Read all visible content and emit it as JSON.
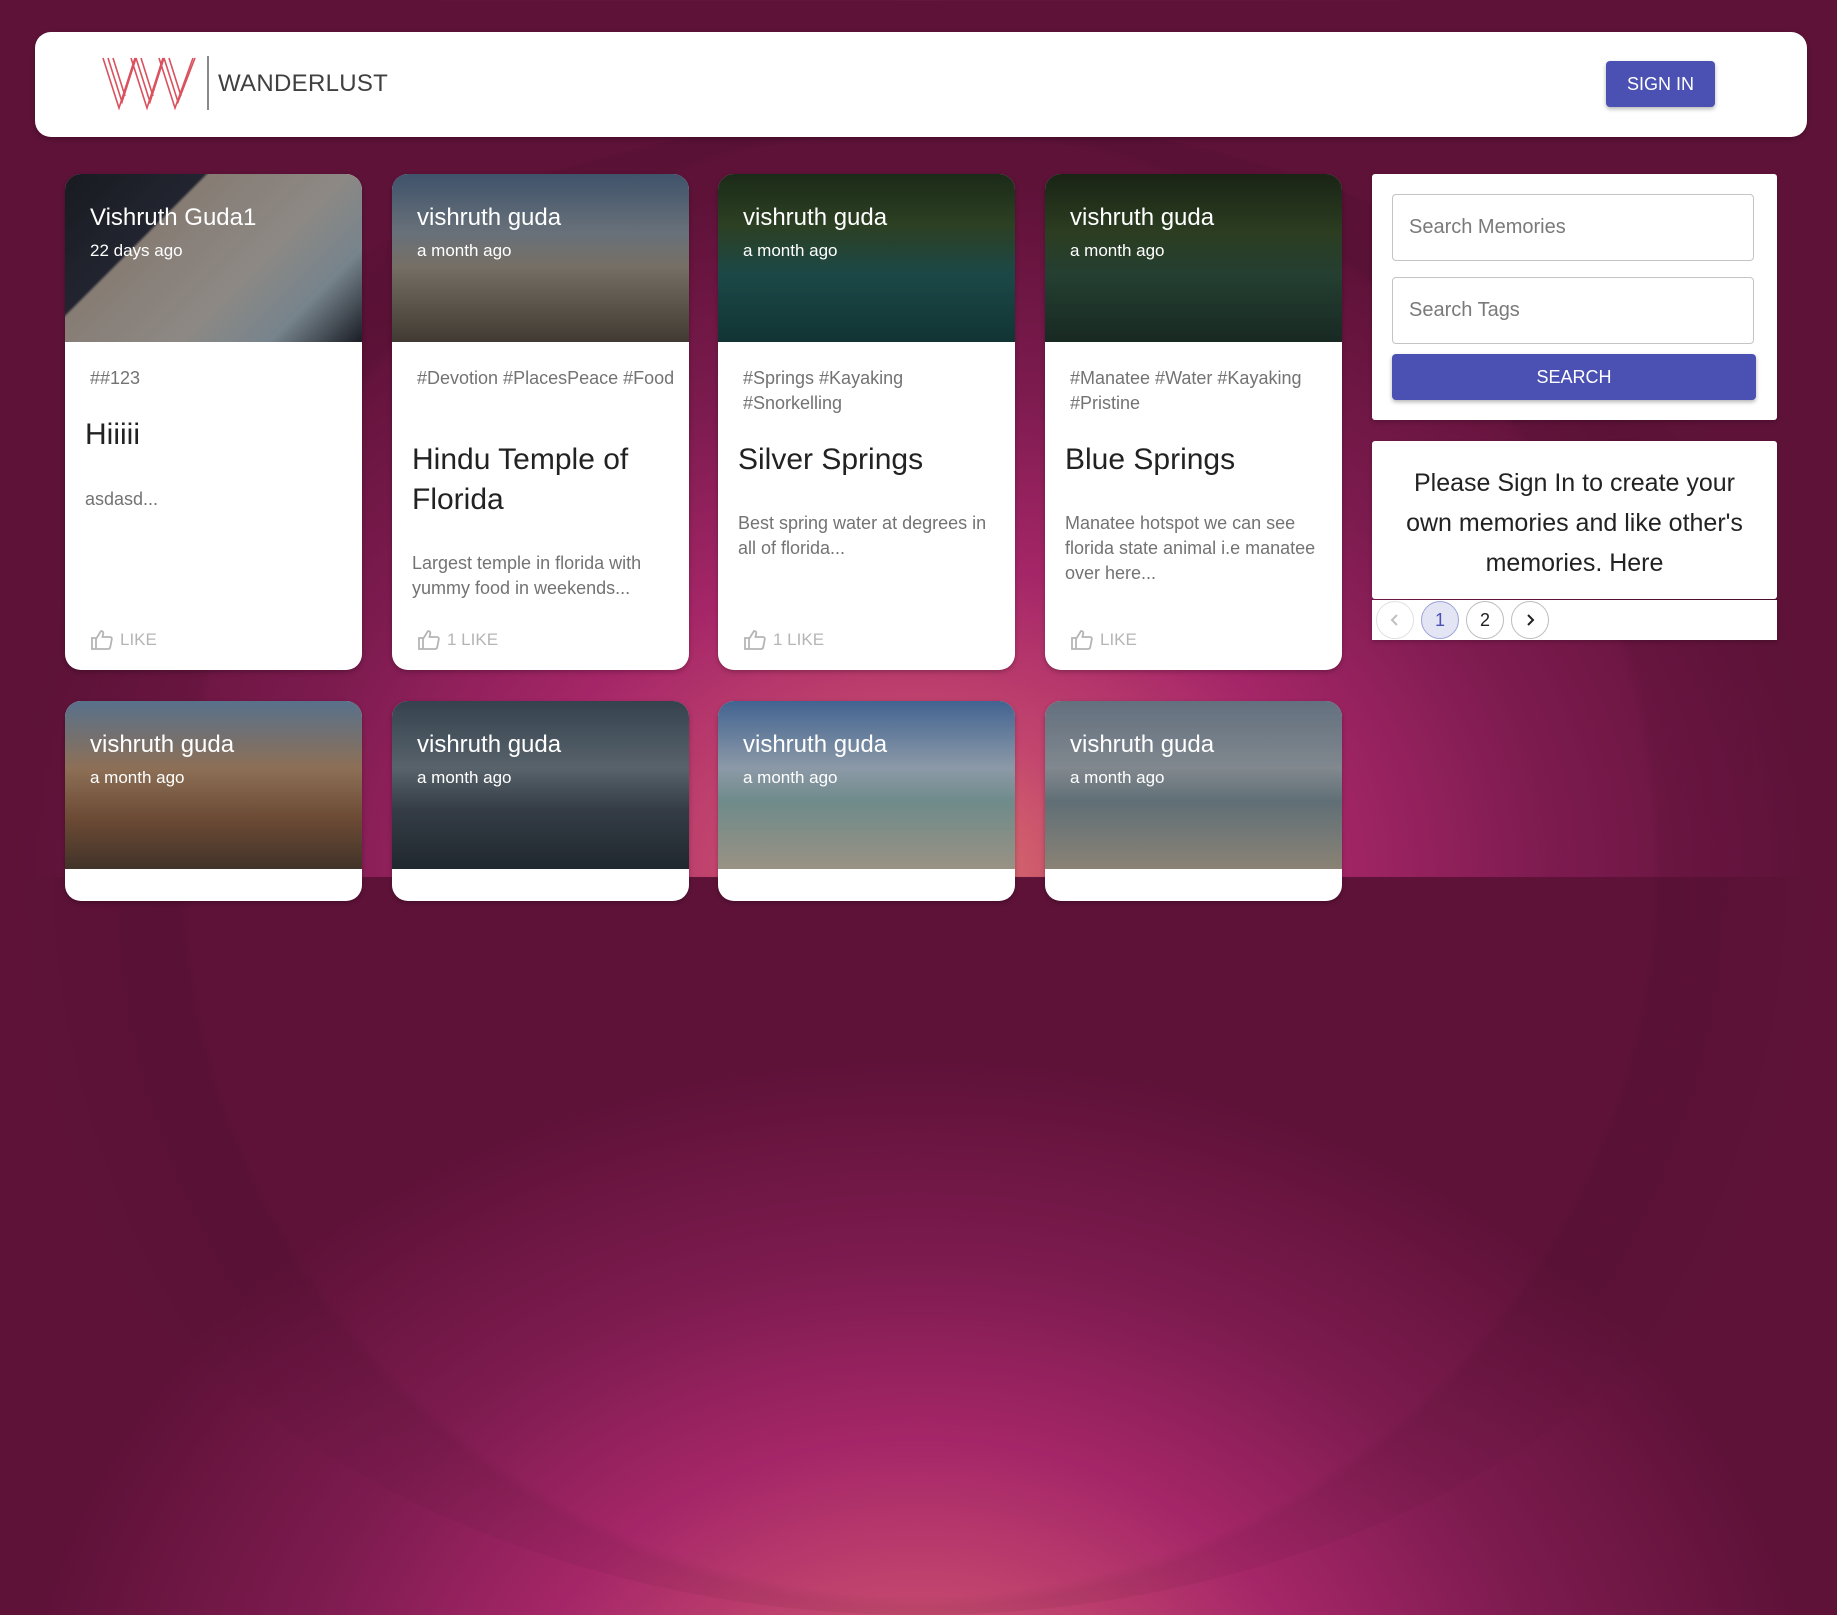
{
  "header": {
    "brand": "WANDERLUST",
    "sign_in_label": "SIGN IN",
    "logo_color": "#d9525e"
  },
  "posts": [
    {
      "author": "Vishruth Guda1",
      "time": "22 days ago",
      "tags": "##123",
      "title": "Hiiiii",
      "desc": "asdasd...",
      "like": "LIKE"
    },
    {
      "author": "vishruth guda",
      "time": "a month ago",
      "tags": "#Devotion #PlacesPeace #Food",
      "title": "Hindu Temple of Florida",
      "desc": "Largest temple in florida with yummy food in weekends...",
      "like": "1 LIKE"
    },
    {
      "author": "vishruth guda",
      "time": "a month ago",
      "tags": "#Springs #Kayaking #Snorkelling",
      "title": "Silver Springs",
      "desc": "Best spring water at degrees in all of florida...",
      "like": "1 LIKE"
    },
    {
      "author": "vishruth guda",
      "time": "a month ago",
      "tags": "#Manatee #Water #Kayaking #Pristine",
      "title": "Blue Springs",
      "desc": "Manatee hotspot we can see florida state animal i.e manatee over here...",
      "like": "LIKE"
    },
    {
      "author": "vishruth guda",
      "time": "a month ago"
    },
    {
      "author": "vishruth guda",
      "time": "a month ago"
    },
    {
      "author": "vishruth guda",
      "time": "a month ago"
    },
    {
      "author": "vishruth guda",
      "time": "a month ago"
    }
  ],
  "search": {
    "memories_placeholder": "Search Memories",
    "tags_placeholder": "Search Tags",
    "button_label": "SEARCH"
  },
  "notice": "Please Sign In to create your own memories and like other's memories. Here",
  "pagination": {
    "prev_icon": "chevron-left-icon",
    "pages": [
      "1",
      "2"
    ],
    "current": "1",
    "next_icon": "chevron-right-icon"
  },
  "colors": {
    "accent": "#4a51b3",
    "background": "#8a1f55"
  }
}
